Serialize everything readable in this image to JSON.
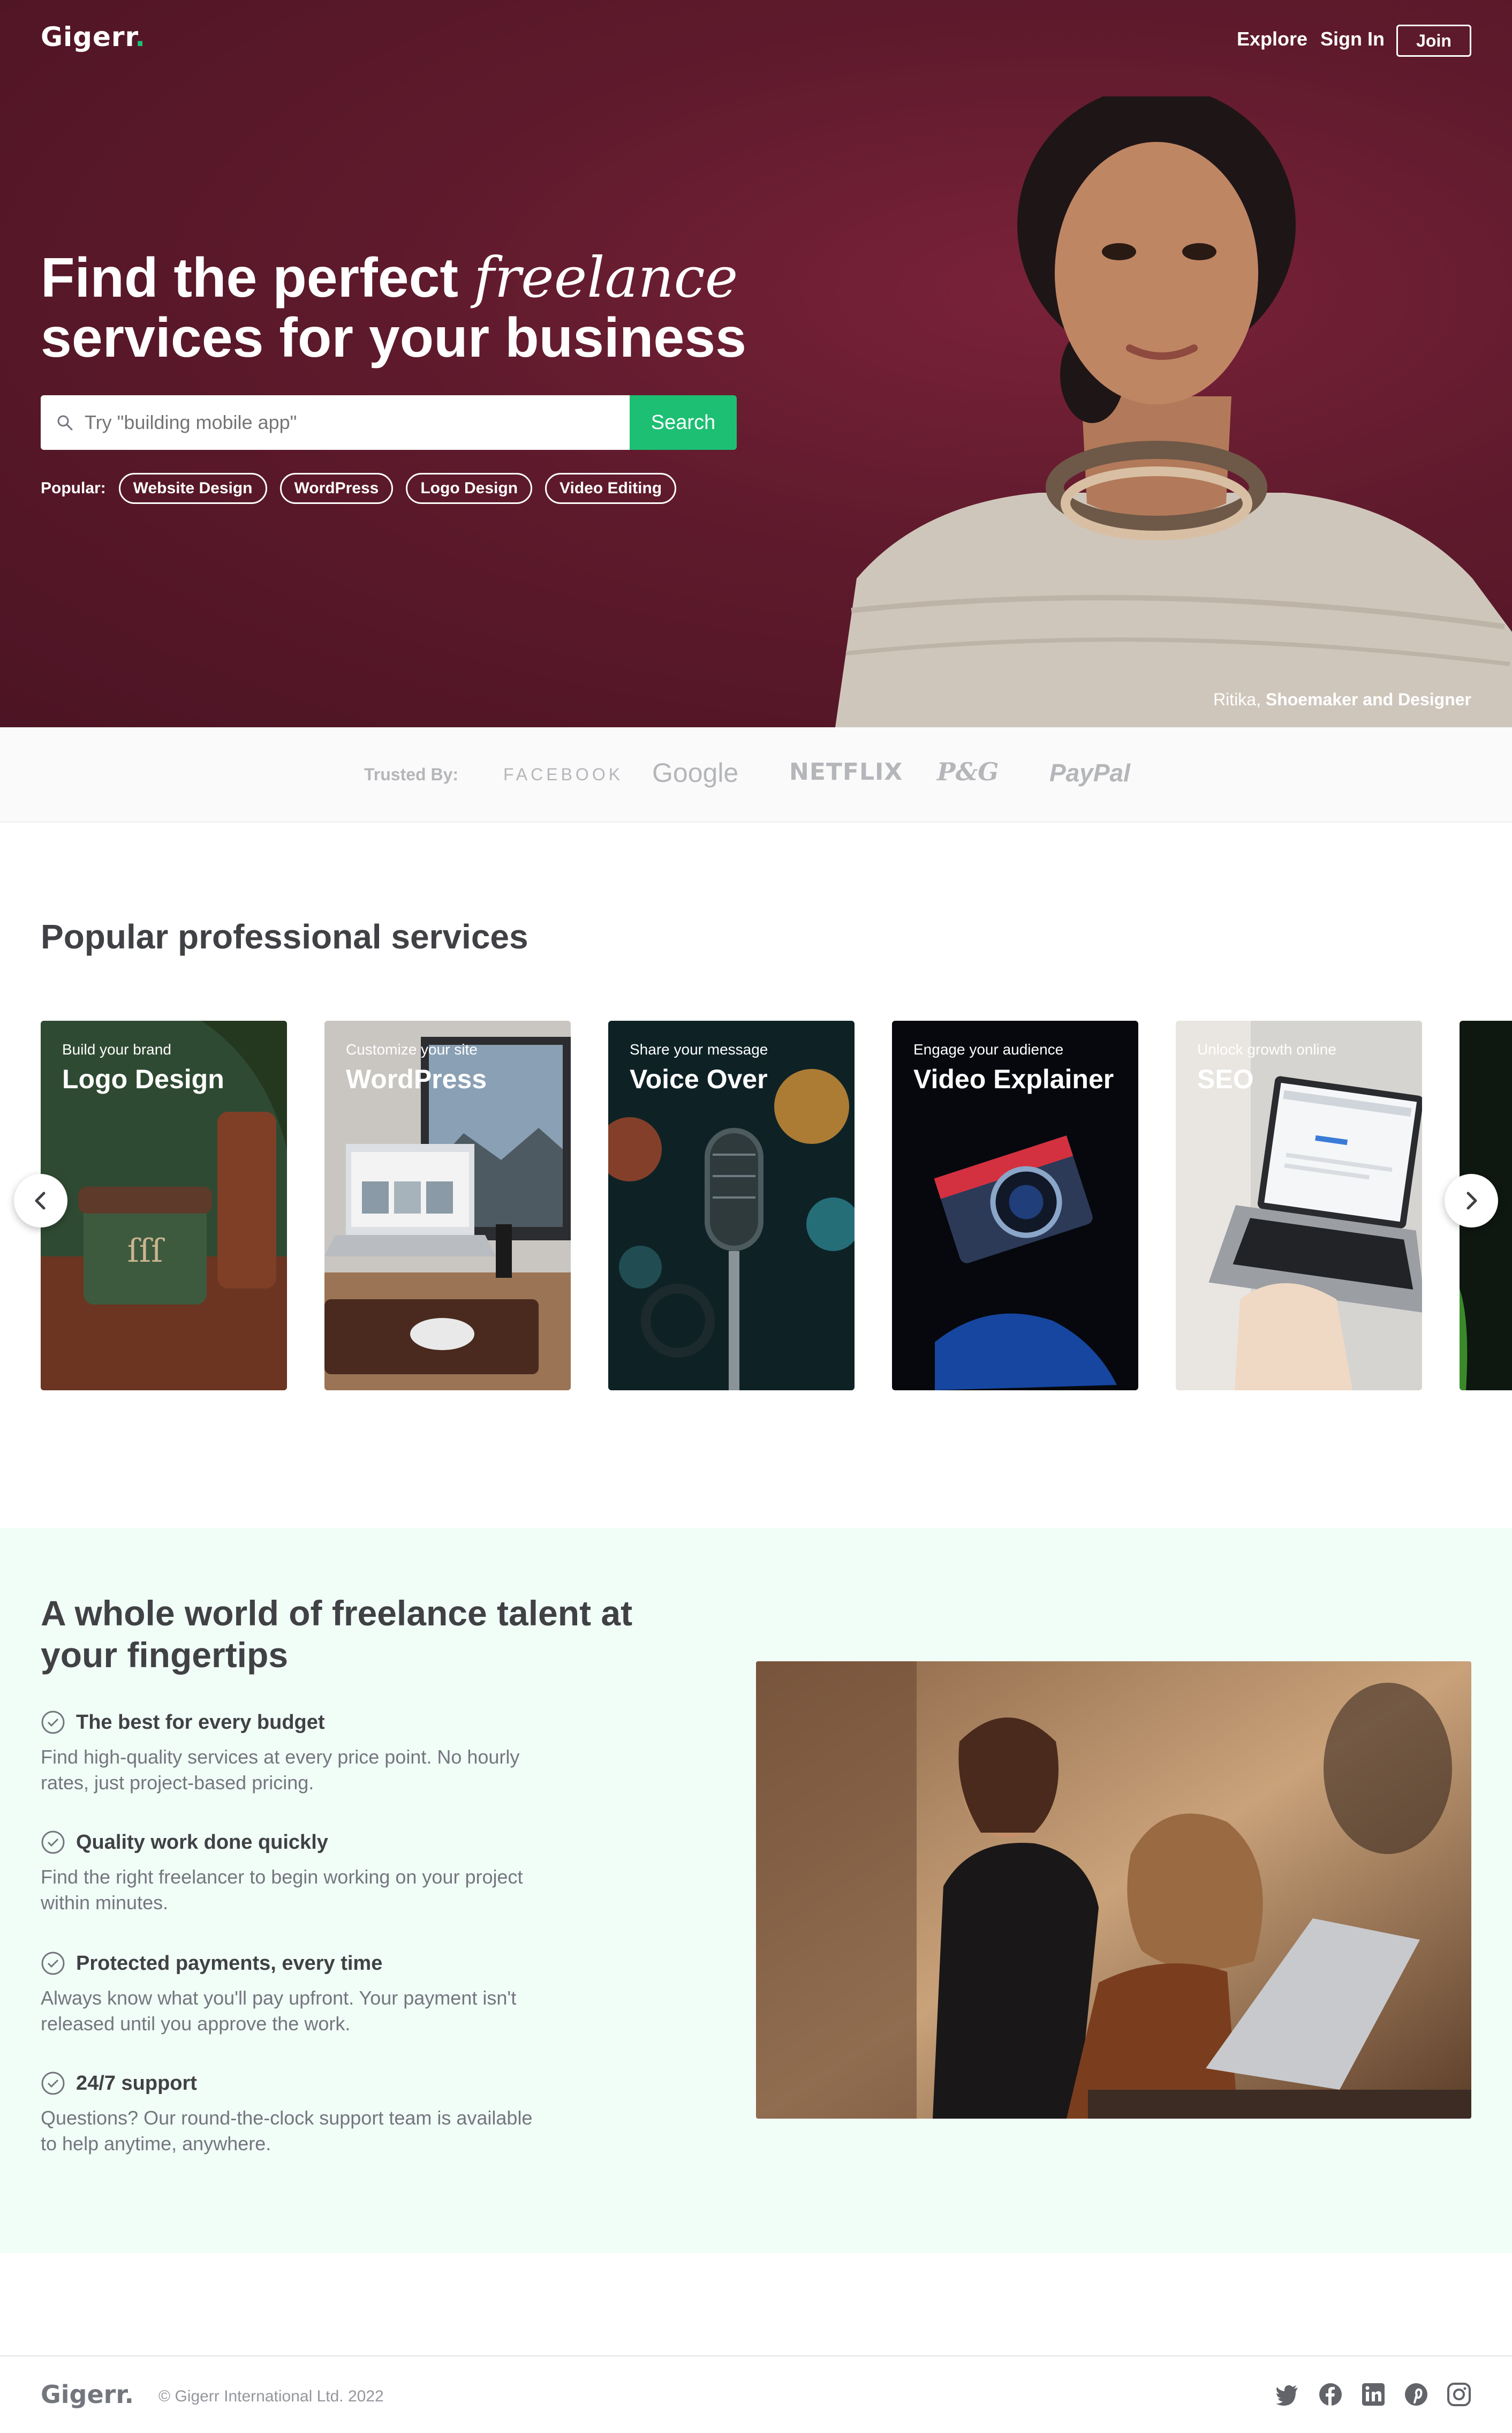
{
  "nav": {
    "logo": "Gigerr",
    "logo_dot": ".",
    "explore": "Explore",
    "sign_in": "Sign In",
    "join": "Join"
  },
  "hero": {
    "title_part1": "Find the perfect ",
    "title_italic": "freelance",
    "title_part2": "services for your business",
    "search_placeholder": "Try \"building mobile app\"",
    "search_button": "Search",
    "popular_label": "Popular:",
    "popular_tags": [
      "Website Design",
      "WordPress",
      "Logo Design",
      "Video Editing"
    ],
    "caption_name": "Ritika,",
    "caption_role": "Shoemaker and Designer"
  },
  "trusted": {
    "label": "Trusted By:",
    "brands": [
      "FACEBOOK",
      "Google",
      "NETFLIX",
      "P&G",
      "PayPal"
    ]
  },
  "services": {
    "title": "Popular professional services",
    "cards": [
      {
        "subtitle": "Build your brand",
        "title": "Logo Design"
      },
      {
        "subtitle": "Customize your site",
        "title": "WordPress"
      },
      {
        "subtitle": "Share your message",
        "title": "Voice Over"
      },
      {
        "subtitle": "Engage your audience",
        "title": "Video Explainer"
      },
      {
        "subtitle": "Unlock growth online",
        "title": "SEO"
      }
    ]
  },
  "talent": {
    "title": "A whole world of freelance talent at your fingertips",
    "features": [
      {
        "title": "The best for every budget",
        "desc": "Find high-quality services at every price point. No hourly rates, just project-based pricing."
      },
      {
        "title": "Quality work done quickly",
        "desc": "Find the right freelancer to begin working on your project within minutes."
      },
      {
        "title": "Protected payments, every time",
        "desc": "Always know what you'll pay upfront. Your payment isn't released until you approve the work."
      },
      {
        "title": "24/7 support",
        "desc": "Questions? Our round-the-clock support team is available to help anytime, anywhere."
      }
    ]
  },
  "footer": {
    "logo": "Gigerr",
    "logo_dot": ".",
    "copyright": "© Gigerr International Ltd. 2022",
    "social": [
      "twitter-icon",
      "facebook-icon",
      "linkedin-icon",
      "pinterest-icon",
      "instagram-icon"
    ]
  },
  "colors": {
    "hero_bg": "#5e1a2c",
    "accent": "#1dbf73",
    "talent_bg": "#f1fdf7"
  }
}
